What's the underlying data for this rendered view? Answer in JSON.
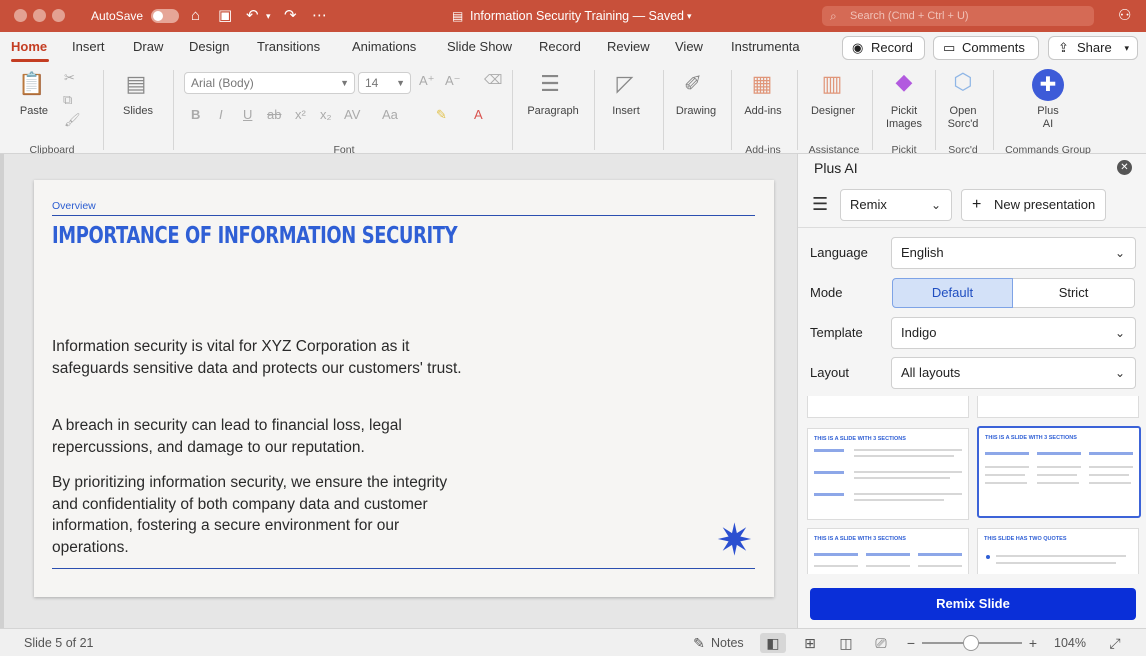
{
  "titlebar": {
    "autosave_label": "AutoSave",
    "doc_title": "Information Security Training — Saved",
    "search_placeholder": "Search (Cmd + Ctrl + U)"
  },
  "tabs": [
    "Home",
    "Insert",
    "Draw",
    "Design",
    "Transitions",
    "Animations",
    "Slide Show",
    "Record",
    "Review",
    "View",
    "Instrumenta"
  ],
  "actions": {
    "record": "Record",
    "comments": "Comments",
    "share": "Share"
  },
  "ribbon": {
    "paste": "Paste",
    "slides": "Slides",
    "font_name": "Arial (Body)",
    "font_size": "14",
    "paragraph": "Paragraph",
    "insert": "Insert",
    "drawing": "Drawing",
    "addins": "Add-ins",
    "designer": "Designer",
    "pickit_line1": "Pickit",
    "pickit_line2": "Images",
    "opensorcd_line1": "Open",
    "opensorcd_line2": "Sorc'd",
    "plusai_line1": "Plus",
    "plusai_line2": "AI",
    "groups": {
      "clipboard": "Clipboard",
      "font": "Font",
      "addins": "Add-ins",
      "assistance": "Assistance",
      "pickit": "Pickit",
      "sorcd": "Sorc'd",
      "commands": "Commands Group"
    }
  },
  "slide": {
    "overview": "Overview",
    "title": "IMPORTANCE OF INFORMATION SECURITY",
    "paragraphs": [
      "Information security is vital for XYZ Corporation as it safeguards sensitive data and protects our customers' trust.",
      "A breach in security can lead to financial loss, legal repercussions, and damage to our reputation.",
      "By prioritizing information security, we ensure the integrity and confidentiality of both company data and customer information, fostering a secure environment for our operations."
    ]
  },
  "panel": {
    "title": "Plus AI",
    "mode_select": "Remix",
    "new_presentation": "New presentation",
    "language_label": "Language",
    "language_value": "English",
    "mode_label": "Mode",
    "mode_default": "Default",
    "mode_strict": "Strict",
    "template_label": "Template",
    "template_value": "Indigo",
    "layout_label": "Layout",
    "layout_value": "All layouts",
    "thumbs": [
      "THIS IS A SLIDE WITH 3 SECTIONS",
      "THIS IS A SLIDE WITH 3 SECTIONS",
      "THIS IS A SLIDE WITH 3 SECTIONS",
      "THIS SLIDE HAS TWO QUOTES"
    ],
    "remix_button": "Remix Slide"
  },
  "status": {
    "slide_counter": "Slide 5 of 21",
    "notes": "Notes",
    "zoom": "104%"
  },
  "colors": {
    "titlebar": "#c8503a",
    "accent": "#c43d22",
    "slide_blue": "#2f5fd5",
    "remix_button": "#0a2fd8"
  }
}
